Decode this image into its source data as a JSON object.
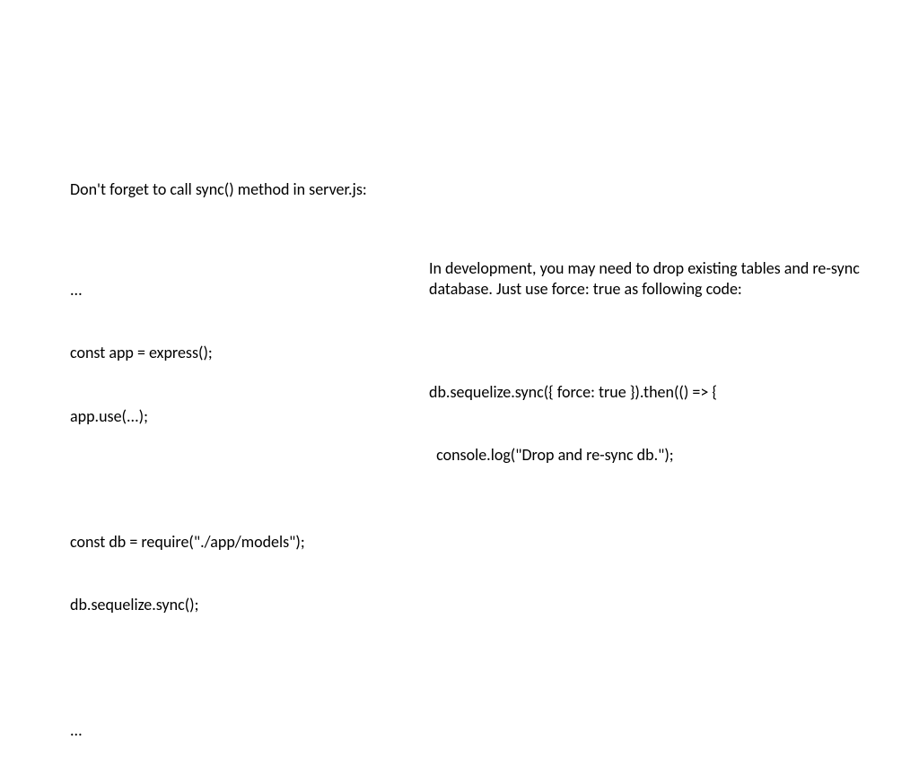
{
  "left": {
    "intro": "Don't forget to call sync() method in server.js:",
    "code_line1": "...",
    "code_line2": "const app = express();",
    "code_line3": "app.use(...);",
    "code_line4": "",
    "code_line5": "const db = require(\"./app/models\");",
    "code_line6": "db.sequelize.sync();",
    "code_line7": "",
    "code_line8": "..."
  },
  "right": {
    "intro": "In development, you may need to drop existing tables and re-sync database. Just use force: true as following code:",
    "code_line1": "db.sequelize.sync({ force: true }).then(() => {",
    "code_line2": "  console.log(\"Drop and re-sync db.\");"
  }
}
